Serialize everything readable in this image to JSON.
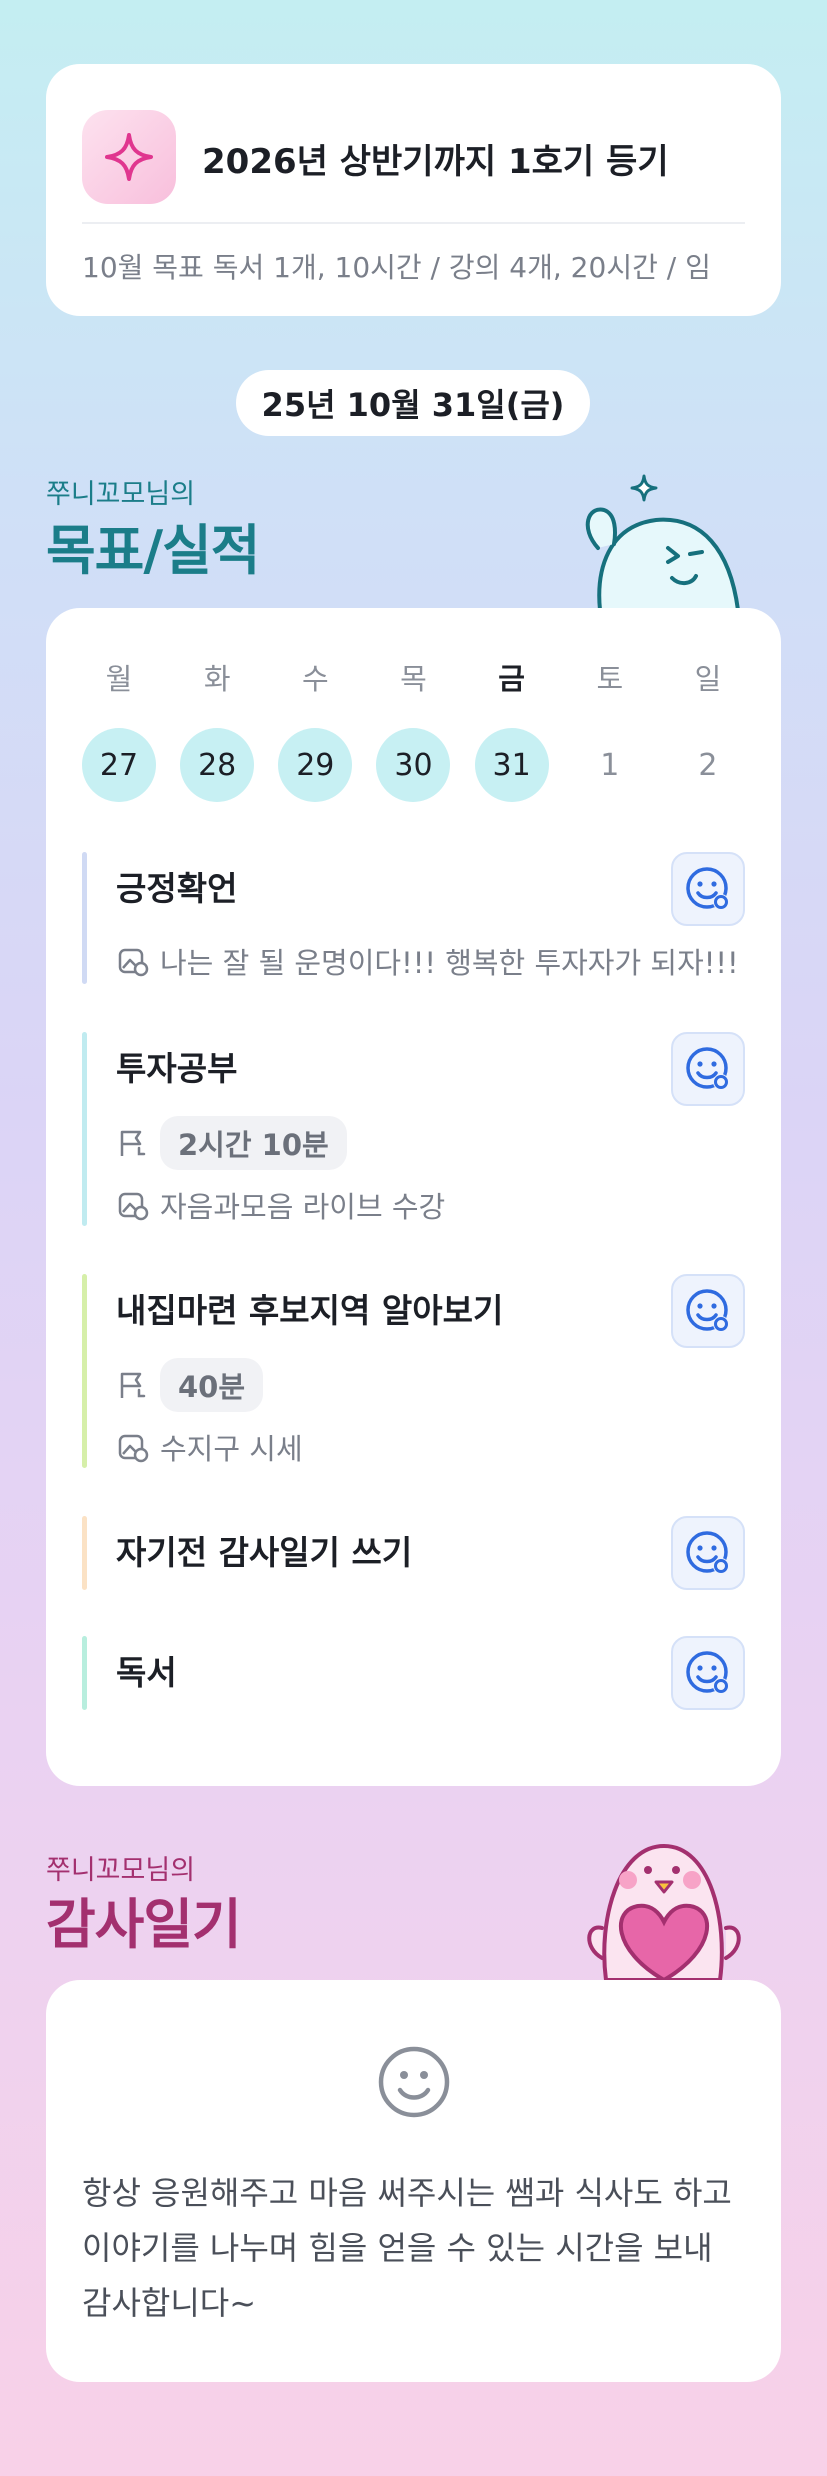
{
  "goal": {
    "icon": "sparkle-icon",
    "title": "2026년 상반기까지 1호기 등기",
    "subtitle": "10월 목표  독서 1개, 10시간 / 강의 4개, 20시간 / 임"
  },
  "date": "25년 10월 31일(금)",
  "performance": {
    "owner": "쭈니꼬모님의",
    "title": "목표/실적",
    "weekdays": [
      "월",
      "화",
      "수",
      "목",
      "금",
      "토",
      "일"
    ],
    "days": [
      "27",
      "28",
      "29",
      "30",
      "31",
      "1",
      "2"
    ],
    "active_weekday_index": 4,
    "completed_days": 5,
    "tasks": [
      {
        "title": "긍정확언",
        "duration": "",
        "note": "나는 잘 될 운명이다!!! 행복한 투자자가 되자!!!",
        "bar_color": "#d0daf4"
      },
      {
        "title": "투자공부",
        "duration": "2시간 10분",
        "note": "자음과모음 라이브 수강",
        "bar_color": "#c0ebf0"
      },
      {
        "title": "내집마련 후보지역 알아보기",
        "duration": "40분",
        "note": "수지구 시세",
        "bar_color": "#d6efa9"
      },
      {
        "title": "자기전 감사일기 쓰기",
        "duration": "",
        "note": "",
        "bar_color": "#fbe2c5"
      },
      {
        "title": "독서",
        "duration": "",
        "note": "",
        "bar_color": "#b8eede"
      }
    ]
  },
  "diary": {
    "owner": "쭈니꼬모님의",
    "title": "감사일기",
    "icon": "smiley-face-icon",
    "text": "항상 응원해주고 마음 써주시는 쌤과 식사도 하고 이야기를 나누며 힘을 얻을 수 있는 시간을 보내 감사합니다~"
  },
  "colors": {
    "accent_teal": "#1b7d89",
    "accent_magenta": "#a3306f",
    "check_blue": "#2f6be0",
    "day_done_bg": "#c7f0f3"
  }
}
